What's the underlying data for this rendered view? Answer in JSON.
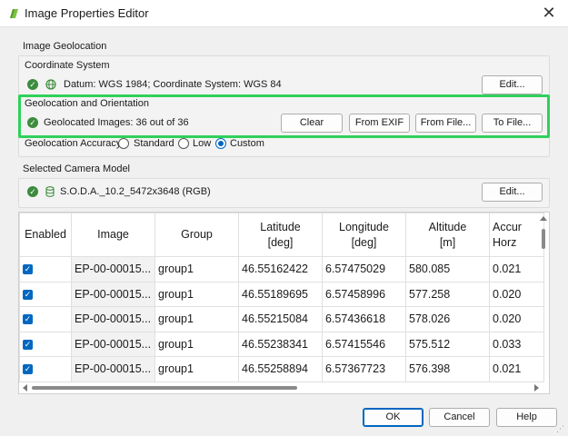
{
  "window": {
    "title": "Image Properties Editor",
    "close_glyph": "✕"
  },
  "icons": {
    "app": "app-logo-icon",
    "check": "✓",
    "globe": "globe-icon",
    "camera": "camera-icon"
  },
  "colors": {
    "highlight": "#2fd15a",
    "accent": "#0067c0",
    "status_ok": "#3d8b3d"
  },
  "geolocation": {
    "section_title": "Image Geolocation",
    "coordinate_system": {
      "label": "Coordinate System",
      "value": "Datum: WGS 1984; Coordinate System: WGS 84",
      "edit_label": "Edit..."
    },
    "orientation": {
      "label": "Geolocation and Orientation",
      "status": "Geolocated Images: 36 out of 36",
      "buttons": {
        "clear": "Clear",
        "from_exif": "From EXIF",
        "from_file": "From File...",
        "to_file": "To File..."
      }
    },
    "accuracy": {
      "label": "Geolocation Accuracy:",
      "options": [
        "Standard",
        "Low",
        "Custom"
      ],
      "selected": "Custom"
    }
  },
  "camera": {
    "section_title": "Selected Camera Model",
    "model": "S.O.D.A._10.2_5472x3648 (RGB)",
    "edit_label": "Edit..."
  },
  "table": {
    "columns": [
      "Enabled",
      "Image",
      "Group",
      "Latitude\n[deg]",
      "Longitude\n[deg]",
      "Altitude\n[m]",
      "Accur\nHorz"
    ],
    "rows": [
      {
        "enabled": true,
        "image": "EP-00-00015...",
        "group": "group1",
        "lat": "46.55162422",
        "lon": "6.57475029",
        "alt": "580.085",
        "acc": "0.021"
      },
      {
        "enabled": true,
        "image": "EP-00-00015...",
        "group": "group1",
        "lat": "46.55189695",
        "lon": "6.57458996",
        "alt": "577.258",
        "acc": "0.020"
      },
      {
        "enabled": true,
        "image": "EP-00-00015...",
        "group": "group1",
        "lat": "46.55215084",
        "lon": "6.57436618",
        "alt": "578.026",
        "acc": "0.020"
      },
      {
        "enabled": true,
        "image": "EP-00-00015...",
        "group": "group1",
        "lat": "46.55238341",
        "lon": "6.57415546",
        "alt": "575.512",
        "acc": "0.033"
      },
      {
        "enabled": true,
        "image": "EP-00-00015...",
        "group": "group1",
        "lat": "46.55258894",
        "lon": "6.57367723",
        "alt": "576.398",
        "acc": "0.021"
      }
    ]
  },
  "footer": {
    "ok": "OK",
    "cancel": "Cancel",
    "help": "Help"
  }
}
